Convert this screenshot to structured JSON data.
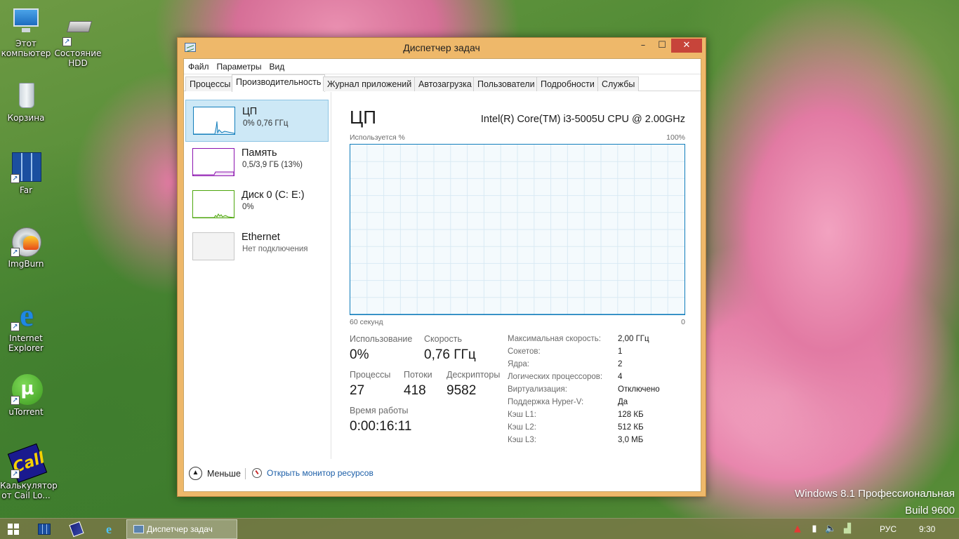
{
  "desktop": {
    "icons": [
      {
        "label_1": "Этот",
        "label_2": "компьютер"
      },
      {
        "label_1": "Состояние",
        "label_2": "HDD"
      },
      {
        "label_1": "Корзина"
      },
      {
        "label_1": "Far"
      },
      {
        "label_1": "ImgBurn"
      },
      {
        "label_1": "Internet",
        "label_2": "Explorer"
      },
      {
        "label_1": "uTorrent"
      },
      {
        "label_1": "Калькулятор",
        "label_2": "от Cail Lo..."
      }
    ],
    "watermark_line1": "Windows 8.1 Профессиональная",
    "watermark_line2": "Build 9600"
  },
  "window": {
    "title": "Диспетчер задач",
    "min_glyph": "–",
    "max_glyph": "☐",
    "close_glyph": "✕",
    "menu": [
      "Файл",
      "Параметры",
      "Вид"
    ],
    "tabs": [
      "Процессы",
      "Производительность",
      "Журнал приложений",
      "Автозагрузка",
      "Пользователи",
      "Подробности",
      "Службы"
    ],
    "active_tab": "Производительность"
  },
  "resources": [
    {
      "title": "ЦП",
      "sub": "0%  0,76 ГГц",
      "color": "#117dbb"
    },
    {
      "title": "Память",
      "sub": "0,5/3,9 ГБ (13%)",
      "color": "#8b12ae"
    },
    {
      "title": "Диск 0 (C: E:)",
      "sub": "0%",
      "color": "#4da60c"
    },
    {
      "title": "Ethernet",
      "sub": "Нет подключения",
      "color": "#a7a7a7"
    }
  ],
  "cpu": {
    "heading": "ЦП",
    "model": "Intel(R) Core(TM) i3-5005U CPU @ 2.00GHz",
    "graph_label": "Используется %",
    "graph_max": "100%",
    "graph_time": "60 секунд",
    "graph_min": "0",
    "usage_label": "Использование",
    "usage_value": "0%",
    "speed_label": "Скорость",
    "speed_value": "0,76 ГГц",
    "processes_label": "Процессы",
    "processes_value": "27",
    "threads_label": "Потоки",
    "threads_value": "418",
    "handles_label": "Дескрипторы",
    "handles_value": "9582",
    "uptime_label": "Время работы",
    "uptime_value": "0:00:16:11",
    "specs": [
      {
        "label": "Максимальная скорость:",
        "value": "2,00 ГГц"
      },
      {
        "label": "Сокетов:",
        "value": "1"
      },
      {
        "label": "Ядра:",
        "value": "2"
      },
      {
        "label": "Логических процессоров:",
        "value": "4"
      },
      {
        "label": "Виртуализация:",
        "value": "Отключено"
      },
      {
        "label": "Поддержка Hyper-V:",
        "value": "Да"
      },
      {
        "label": "Кэш L1:",
        "value": "128 КБ"
      },
      {
        "label": "Кэш L2:",
        "value": "512 КБ"
      },
      {
        "label": "Кэш L3:",
        "value": "3,0 МБ"
      }
    ]
  },
  "chart_data": {
    "type": "area",
    "x": [
      0,
      1,
      2,
      3,
      4,
      5,
      6,
      7,
      8,
      9,
      10,
      11,
      12,
      13,
      14,
      15,
      16,
      17,
      18,
      19,
      20,
      21,
      22,
      23,
      24,
      25,
      26,
      27,
      28,
      29,
      30,
      31,
      32,
      33,
      34,
      35,
      36,
      37,
      38,
      39,
      40,
      41,
      42,
      43,
      44,
      45,
      46,
      47,
      48,
      49,
      50,
      51,
      52,
      53,
      54,
      55,
      56,
      57,
      58,
      59,
      60
    ],
    "series": [
      {
        "values": [
          0,
          0,
          0,
          0,
          0,
          0,
          0,
          0,
          0,
          0,
          0,
          0,
          0,
          0,
          0,
          0,
          0,
          0,
          0,
          0,
          0,
          0,
          0,
          0,
          0,
          0,
          0,
          0,
          0,
          0,
          0,
          0,
          0,
          0,
          0,
          0,
          0,
          0,
          0,
          0,
          0,
          0,
          0,
          0,
          0,
          0,
          0,
          0,
          0,
          0,
          0,
          0,
          0,
          0,
          0,
          0,
          0,
          0,
          0,
          0,
          0
        ]
      }
    ],
    "values": [
      0,
      0,
      0,
      0,
      0,
      0,
      0,
      0,
      0,
      0,
      0,
      0,
      0,
      0,
      0,
      0,
      0,
      0,
      0,
      0,
      0,
      0,
      0,
      0,
      0,
      0,
      0,
      0,
      0,
      0,
      0,
      0,
      0,
      0,
      0,
      0,
      0,
      0,
      0,
      0,
      0,
      0,
      0,
      0,
      0,
      0,
      0,
      0,
      0,
      0,
      0,
      0,
      0,
      0,
      0,
      0,
      0,
      0,
      0,
      0,
      0
    ],
    "ylim": [
      0,
      100
    ],
    "ylabel": "Используется %",
    "xlabel": "60 секунд",
    "color": "#117dbb",
    "grid": true
  },
  "bottom": {
    "less_label": "Меньше",
    "monitor_label": "Открыть монитор ресурсов"
  },
  "taskbar": {
    "task_label": "Диспетчер задач",
    "lang": "РУС",
    "time": "9:30"
  }
}
